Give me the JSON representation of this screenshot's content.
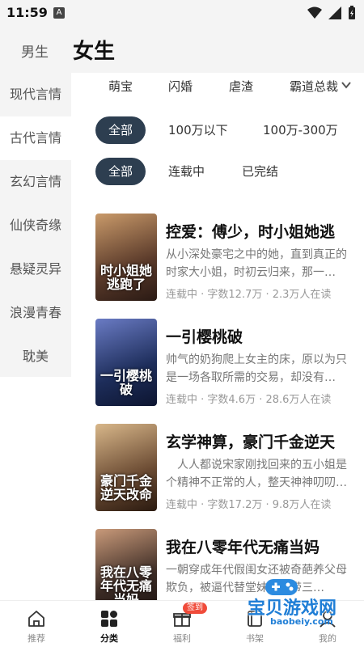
{
  "status_bar": {
    "time": "11:59",
    "notification_letter": "A"
  },
  "header": {
    "male_tab": "男生",
    "female_tab": "女生"
  },
  "sidebar": {
    "items": [
      {
        "label": "现代言情"
      },
      {
        "label": "古代言情"
      },
      {
        "label": "玄幻言情"
      },
      {
        "label": "仙侠奇缘"
      },
      {
        "label": "悬疑灵异"
      },
      {
        "label": "浪漫青春"
      },
      {
        "label": "耽美"
      }
    ]
  },
  "tags": [
    "萌宝",
    "闪婚",
    "虐渣",
    "霸道总裁"
  ],
  "filters": {
    "word_count": [
      "全部",
      "100万以下",
      "100万-300万"
    ],
    "status": [
      "全部",
      "连载中",
      "已完结"
    ]
  },
  "books": [
    {
      "title": "控爱：傅少，时小姐她逃",
      "description": "从小深处豪宅之中的她，直到真正的时家大小姐，时初云归来，那一…",
      "meta": "连载中 · 字数12.7万 · 2.3万人在读",
      "cover_text": "时小姐她逃跑了",
      "cover_colors": [
        "#5a3a2a",
        "#c99a6a"
      ]
    },
    {
      "title": "一引樱桃破",
      "description": "帅气的奶狗爬上女主的床，原以为只是一场各取所需的交易，却没有…",
      "meta": "连载中 · 字数4.6万 · 28.6万人在读",
      "cover_text": "一引樱桃破",
      "cover_colors": [
        "#1d2d5a",
        "#6a7bc4"
      ]
    },
    {
      "title": "玄学神算，豪门千金逆天",
      "description": "人人都说宋家刚找回来的五小姐是个精神不正常的人，整天神神叨叨…",
      "meta": "连载中 · 字数17.2万 · 9.8万人在读",
      "cover_text": "豪门千金逆天改命",
      "cover_colors": [
        "#6a4a32",
        "#d8b78a"
      ]
    },
    {
      "title": "我在八零年代无痛当妈",
      "description": "一朝穿成年代假闺女还被奇葩养父母欺负，被逼代替堂妹嫁给带三…",
      "meta": "",
      "cover_text": "我在八零年代无痛当妈",
      "cover_colors": [
        "#3a2a24",
        "#c99a7a"
      ]
    }
  ],
  "bottom_nav": {
    "items": [
      {
        "label": "推荐",
        "icon": "home-icon"
      },
      {
        "label": "分类",
        "icon": "category-icon"
      },
      {
        "label": "福利",
        "icon": "gift-icon",
        "badge": "签到"
      },
      {
        "label": "书架",
        "icon": "bookshelf-icon"
      },
      {
        "label": "我的",
        "icon": "profile-icon"
      }
    ]
  },
  "watermark": {
    "text": "宝贝游戏网",
    "url": "baobeiy.com"
  },
  "colors": {
    "active_pill": "#2d3e50",
    "badge": "#f04b3a",
    "watermark": "#1f7ed6"
  }
}
